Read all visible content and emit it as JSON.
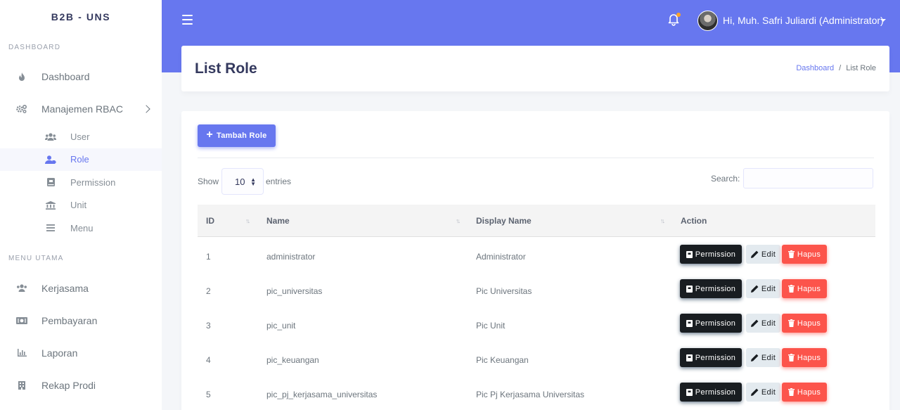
{
  "brand": "B2B - UNS",
  "sidebar": {
    "sections": [
      {
        "header": "DASHBOARD"
      },
      {
        "header": "MENU UTAMA"
      }
    ],
    "dashboard_items": [
      {
        "label": "Dashboard",
        "icon": "fire-icon"
      },
      {
        "label": "Manajemen RBAC",
        "icon": "cogs-icon"
      }
    ],
    "rbac_sub_items": [
      {
        "label": "User",
        "icon": "users-icon"
      },
      {
        "label": "Role",
        "icon": "user-tag-icon",
        "active": true
      },
      {
        "label": "Permission",
        "icon": "book-icon"
      },
      {
        "label": "Unit",
        "icon": "university-icon"
      },
      {
        "label": "Menu",
        "icon": "bars-icon"
      }
    ],
    "main_items": [
      {
        "label": "Kerjasama",
        "icon": "users-icon"
      },
      {
        "label": "Pembayaran",
        "icon": "money-icon"
      },
      {
        "label": "Laporan",
        "icon": "chart-icon"
      },
      {
        "label": "Rekap Prodi",
        "icon": "building-icon"
      }
    ]
  },
  "topbar": {
    "user_greeting": "Hi, Muh. Safri Juliardi (Administrator)",
    "accent_color": "#6777ef"
  },
  "header": {
    "title": "List Role",
    "breadcrumb": [
      "Dashboard",
      "/",
      "List Role"
    ]
  },
  "main": {
    "add_button_label": "Tambah Role",
    "show_label": "Show",
    "entries_value": "10",
    "entries_label": "entries",
    "search_label": "Search:",
    "search_value": "",
    "columns": [
      "ID",
      "Name",
      "Display Name",
      "Action"
    ],
    "action_labels": {
      "permission": "Permission",
      "edit": "Edit",
      "delete": "Hapus"
    },
    "rows": [
      {
        "id": "1",
        "name": "administrator",
        "display_name": "Administrator"
      },
      {
        "id": "2",
        "name": "pic_universitas",
        "display_name": "Pic Universitas"
      },
      {
        "id": "3",
        "name": "pic_unit",
        "display_name": "Pic Unit"
      },
      {
        "id": "4",
        "name": "pic_keuangan",
        "display_name": "Pic Keuangan"
      },
      {
        "id": "5",
        "name": "pic_pj_kerjasama_universitas",
        "display_name": "Pic Pj Kerjasama Universitas"
      }
    ]
  }
}
